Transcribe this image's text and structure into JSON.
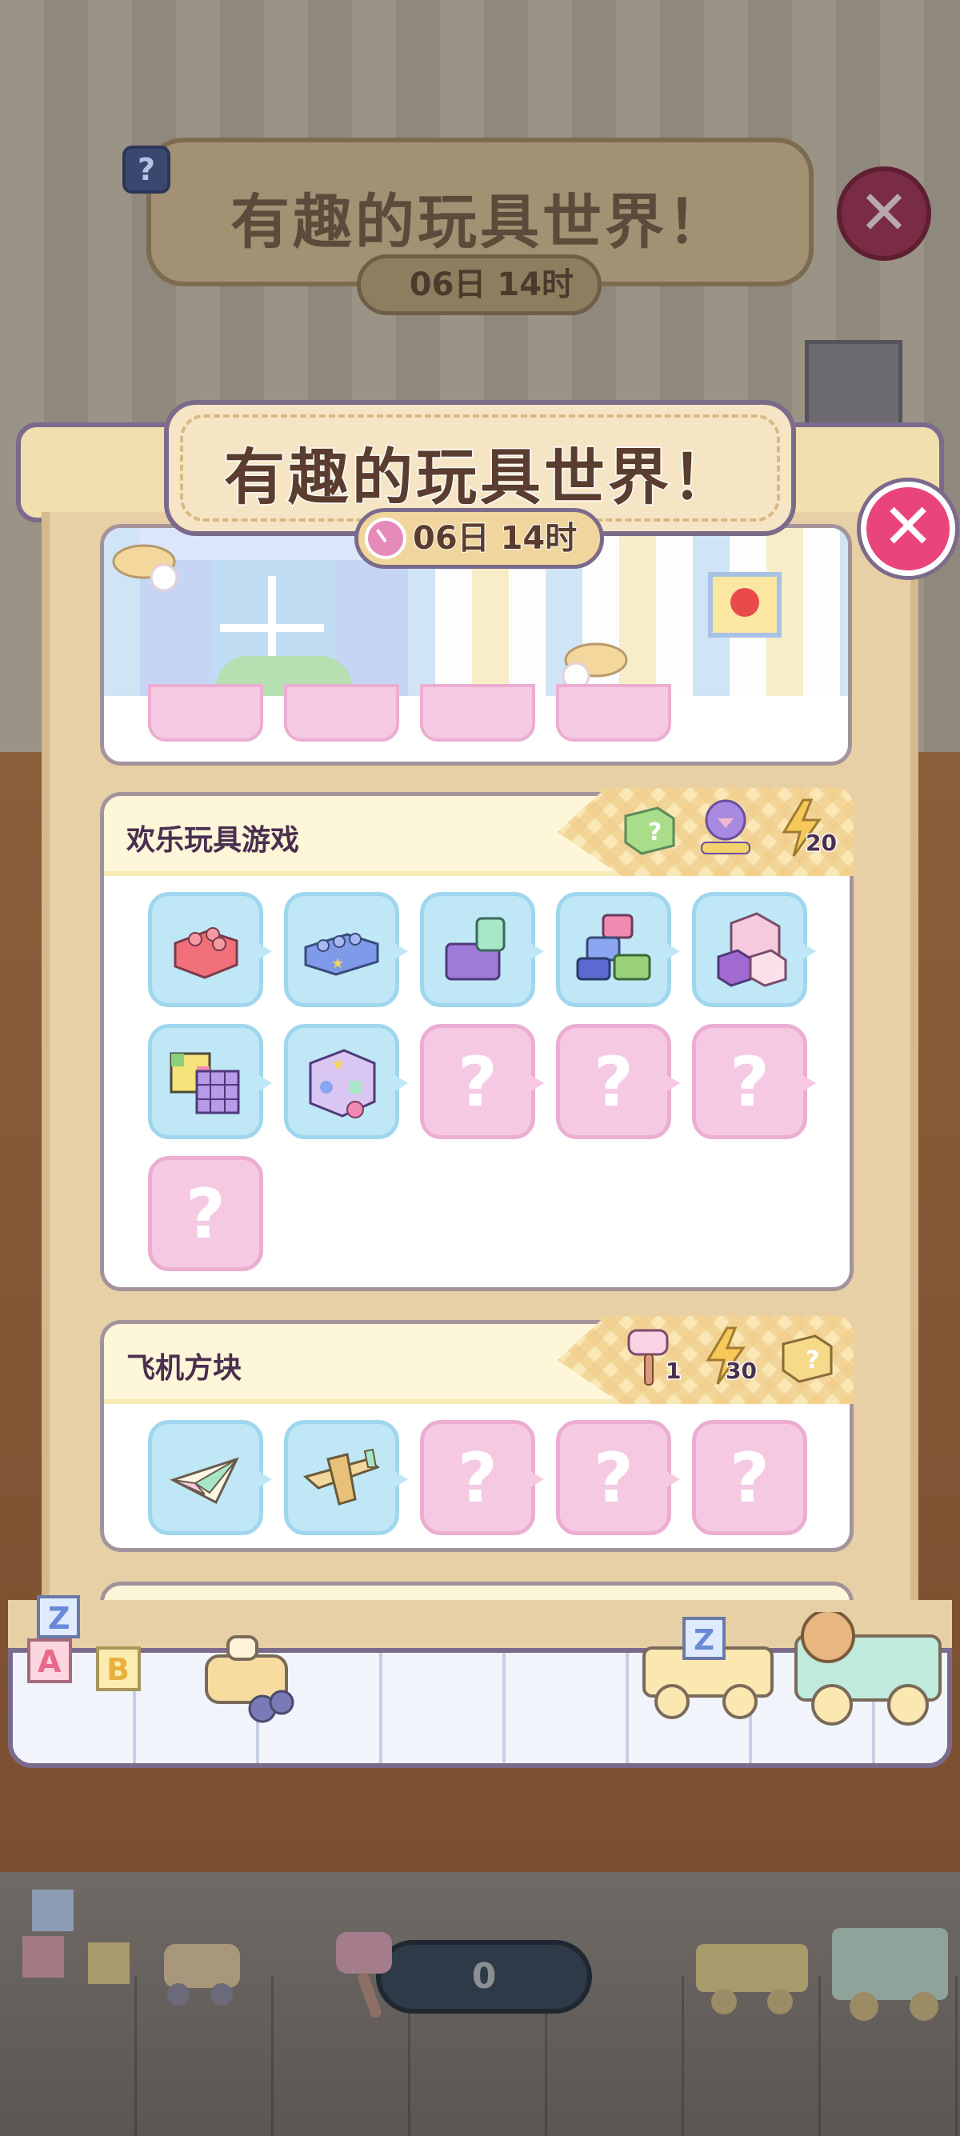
{
  "background": {
    "title": "有趣的玩具世界！",
    "timer": "06日 14时",
    "help_icon": "?",
    "close_icon": "✕",
    "counter": "0"
  },
  "event": {
    "title": "有趣的玩具世界！",
    "timer": "06日 14时",
    "close_icon": "✕"
  },
  "sections": [
    {
      "title": "欢乐玩具游戏",
      "rewards": [
        {
          "icon": "mystery-green-box-icon",
          "label": ""
        },
        {
          "icon": "purple-trophy-stars-icon",
          "label": ""
        },
        {
          "icon": "lightning-energy-icon",
          "label": "20"
        }
      ],
      "slots": [
        {
          "state": "unlocked",
          "icon": "red-brick-icon"
        },
        {
          "state": "unlocked",
          "icon": "blue-brick-icon"
        },
        {
          "state": "unlocked",
          "icon": "purple-brick-stack-icon"
        },
        {
          "state": "unlocked",
          "icon": "colorful-brick-tower-icon"
        },
        {
          "state": "unlocked",
          "icon": "pink-blocks-icon"
        },
        {
          "state": "unlocked",
          "icon": "rubiks-cube-icon"
        },
        {
          "state": "unlocked",
          "icon": "shape-sorter-icon"
        },
        {
          "state": "locked",
          "label": "?"
        },
        {
          "state": "locked",
          "label": "?"
        },
        {
          "state": "locked",
          "label": "?"
        },
        {
          "state": "locked",
          "label": "?"
        }
      ]
    },
    {
      "title": "飞机方块",
      "rewards": [
        {
          "icon": "pink-mallet-icon",
          "label": "1"
        },
        {
          "icon": "lightning-energy-icon",
          "label": "30"
        },
        {
          "icon": "mystery-gold-box-icon",
          "label": ""
        }
      ],
      "slots": [
        {
          "state": "unlocked",
          "icon": "paper-plane-icon"
        },
        {
          "state": "unlocked",
          "icon": "wooden-airplane-icon"
        },
        {
          "state": "locked",
          "label": "?"
        },
        {
          "state": "locked",
          "label": "?"
        },
        {
          "state": "locked",
          "label": "?"
        }
      ]
    }
  ],
  "colors": {
    "accent_pink": "#e9457c",
    "outline_purple": "#7b6a8b",
    "slot_unlocked": "#bfe7f6",
    "slot_locked": "#f6c9e3"
  }
}
